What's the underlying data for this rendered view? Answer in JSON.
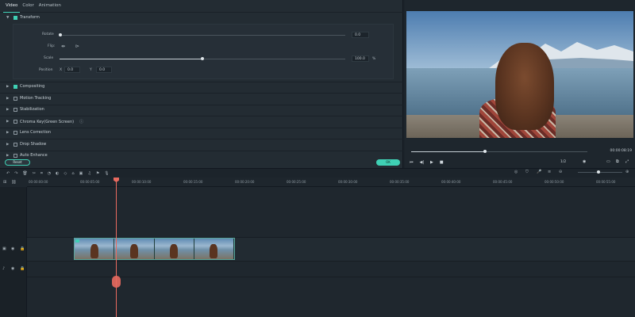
{
  "tabs": [
    {
      "label": "Video",
      "active": true
    },
    {
      "label": "Color",
      "active": false
    },
    {
      "label": "Animation",
      "active": false
    }
  ],
  "transform": {
    "title": "Transform",
    "rotate_label": "Rotate",
    "rotate_value": "0.0",
    "flip_label": "Flip:",
    "scale_label": "Scale",
    "scale_value": "100.0",
    "scale_unit": "%",
    "scale_fraction": 0.5,
    "position_label": "Position",
    "pos_x_label": "X",
    "pos_x_value": "0.0",
    "pos_y_label": "Y",
    "pos_y_value": "0.0"
  },
  "sections": [
    {
      "label": "Compositing",
      "checked": true
    },
    {
      "label": "Motion Tracking",
      "checked": false
    },
    {
      "label": "Stabilization",
      "checked": false
    },
    {
      "label": "Chroma Key(Green Screen)",
      "checked": false
    },
    {
      "label": "Lens Correction",
      "checked": false
    },
    {
      "label": "Drop Shadow",
      "checked": false
    },
    {
      "label": "Auto Enhance",
      "checked": false
    }
  ],
  "buttons": {
    "reset": "Reset",
    "ok": "OK"
  },
  "preview": {
    "timecode": "00:00:08:19",
    "progress": 0.42,
    "ratio": "1/2"
  },
  "ruler": {
    "labels": [
      "00:00:00:00",
      "00:00:05:00",
      "00:00:10:00",
      "00:00:15:00",
      "00:00:20:00",
      "00:00:25:00",
      "00:00:30:00",
      "00:00:35:00",
      "00:00:40:00",
      "00:00:45:00",
      "00:00:50:00",
      "00:00:55:00"
    ]
  },
  "colors": {
    "accent": "#3fd0b4",
    "playhead": "#e86a5f"
  }
}
